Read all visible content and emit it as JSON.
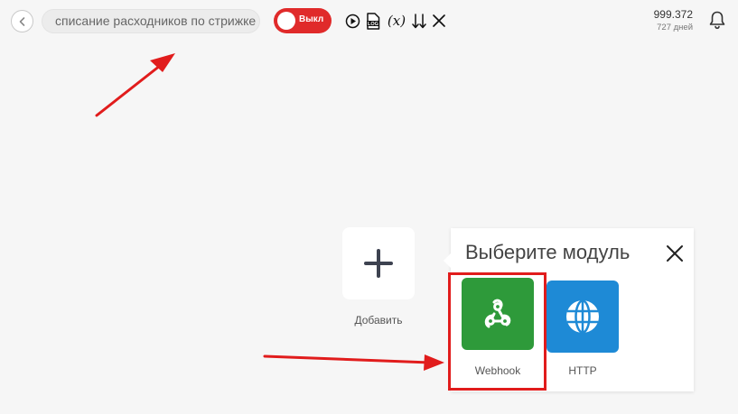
{
  "header": {
    "scenario_name": "списание расходников по стрижке",
    "toggle_label": "Выкл",
    "ops_count": "999.372",
    "ops_days": "727 дней",
    "toolbar_icons": [
      "run-once-icon",
      "log-icon",
      "variables-icon",
      "sort-icon",
      "close-icon"
    ],
    "variables_glyph": "(x)",
    "log_glyph": "LOG"
  },
  "canvas": {
    "add_label": "Добавить"
  },
  "module_picker": {
    "title": "Выберите модуль",
    "modules": [
      {
        "label": "Webhook",
        "icon": "webhook-icon",
        "color": "#2e9a3a"
      },
      {
        "label": "HTTP",
        "icon": "globe-icon",
        "color": "#1e8ad6"
      }
    ]
  },
  "colors": {
    "toggle_off": "#e02a2a",
    "annotation_red": "#e11c1c",
    "background": "#f6f6f6"
  }
}
